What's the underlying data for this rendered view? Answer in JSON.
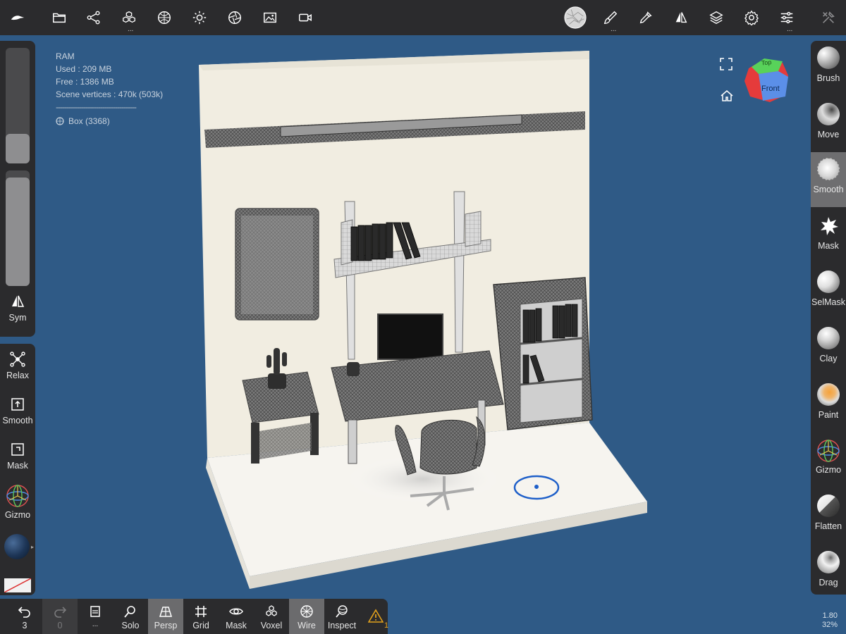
{
  "topbar": {
    "icons": [
      "logo-icon",
      "folder-icon",
      "share-icon",
      "cubes-icon",
      "sphere-icon",
      "sun-icon",
      "aperture-icon",
      "image-icon",
      "video-icon",
      "matcap-icon",
      "brush-icon",
      "pipette-icon",
      "symmetry-icon",
      "layers-icon",
      "gear-icon",
      "sliders-icon",
      "tools-icon"
    ],
    "dots": "..."
  },
  "hud": {
    "ram_label": "RAM",
    "used": "Used : 209 MB",
    "free": "Free : 1386 MB",
    "vertices": "Scene vertices : 470k (503k)",
    "separator": "--------------------------------------",
    "object": "Box (3368)"
  },
  "left_panel": {
    "sym_label": "Sym",
    "slider_top_fraction": 0.2,
    "slider_bottom_fraction": 1.0,
    "tools": [
      {
        "label": "Relax",
        "icon": "relax-icon"
      },
      {
        "label": "Smooth",
        "icon": "smooth-box-icon"
      },
      {
        "label": "Mask",
        "icon": "mask-box-icon"
      },
      {
        "label": "Gizmo",
        "icon": "gizmo-icon"
      }
    ]
  },
  "right_panel": {
    "tools": [
      {
        "label": "Brush",
        "active": false
      },
      {
        "label": "Move",
        "active": false
      },
      {
        "label": "Smooth",
        "active": true
      },
      {
        "label": "Mask",
        "active": false
      },
      {
        "label": "SelMask",
        "active": false
      },
      {
        "label": "Clay",
        "active": false
      },
      {
        "label": "Paint",
        "active": false
      },
      {
        "label": "Gizmo",
        "active": false
      },
      {
        "label": "Flatten",
        "active": false
      },
      {
        "label": "Drag",
        "active": false
      }
    ]
  },
  "bottom_bar": {
    "undo_count": "3",
    "redo_count": "0",
    "more": "...",
    "buttons": [
      {
        "label": "Solo",
        "on": false
      },
      {
        "label": "Persp",
        "on": true
      },
      {
        "label": "Grid",
        "on": false
      },
      {
        "label": "Mask",
        "on": false
      },
      {
        "label": "Voxel",
        "on": false
      },
      {
        "label": "Wire",
        "on": true
      },
      {
        "label": "Inspect",
        "on": false
      }
    ],
    "warning_count": "1"
  },
  "nav_cube": {
    "top": "Top",
    "front": "Front"
  },
  "zoom": {
    "line1": "1.80",
    "line2": "32%"
  },
  "colors": {
    "background": "#2f5a86",
    "panel": "#2b2b2d",
    "active": "#6e6e70",
    "cursor": "#1e5fc9"
  }
}
